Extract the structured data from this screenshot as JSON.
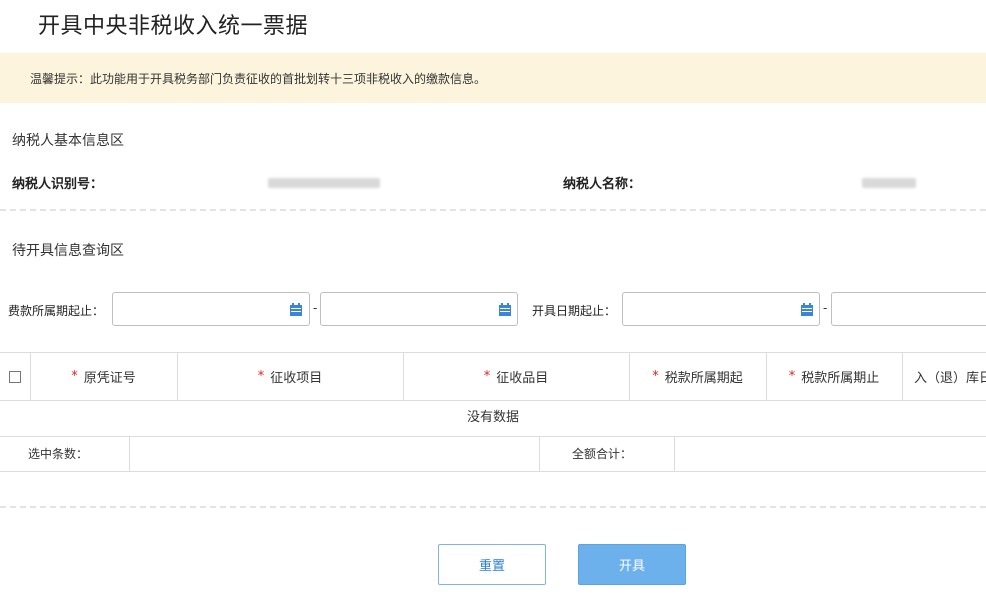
{
  "page": {
    "title": "开具中央非税收入统一票据"
  },
  "notice": {
    "text": "温馨提示：此功能用于开具税务部门负责征收的首批划转十三项非税收入的缴款信息。"
  },
  "taxpayer": {
    "section_title": "纳税人基本信息区",
    "id_label": "纳税人识别号：",
    "name_label": "纳税人名称："
  },
  "query": {
    "section_title": "待开具信息查询区",
    "period_label": "费款所属期起止：",
    "date_label": "开具日期起止：",
    "separator": "-"
  },
  "table": {
    "columns": [
      {
        "label": "原凭证号",
        "required": "*"
      },
      {
        "label": "征收项目",
        "required": "*"
      },
      {
        "label": "征收品目",
        "required": "*"
      },
      {
        "label": "税款所属期起",
        "required": "*"
      },
      {
        "label": "税款所属期止",
        "required": "*"
      },
      {
        "label": "入（退）库日",
        "required": ""
      }
    ],
    "empty_text": "没有数据"
  },
  "summary": {
    "selected_label": "选中条数：",
    "total_label": "全额合计："
  },
  "buttons": {
    "reset": "重置",
    "issue": "开具"
  },
  "colors": {
    "notice_bg": "#fcf4dc",
    "primary": "#6db1ec",
    "required": "#e02020"
  }
}
